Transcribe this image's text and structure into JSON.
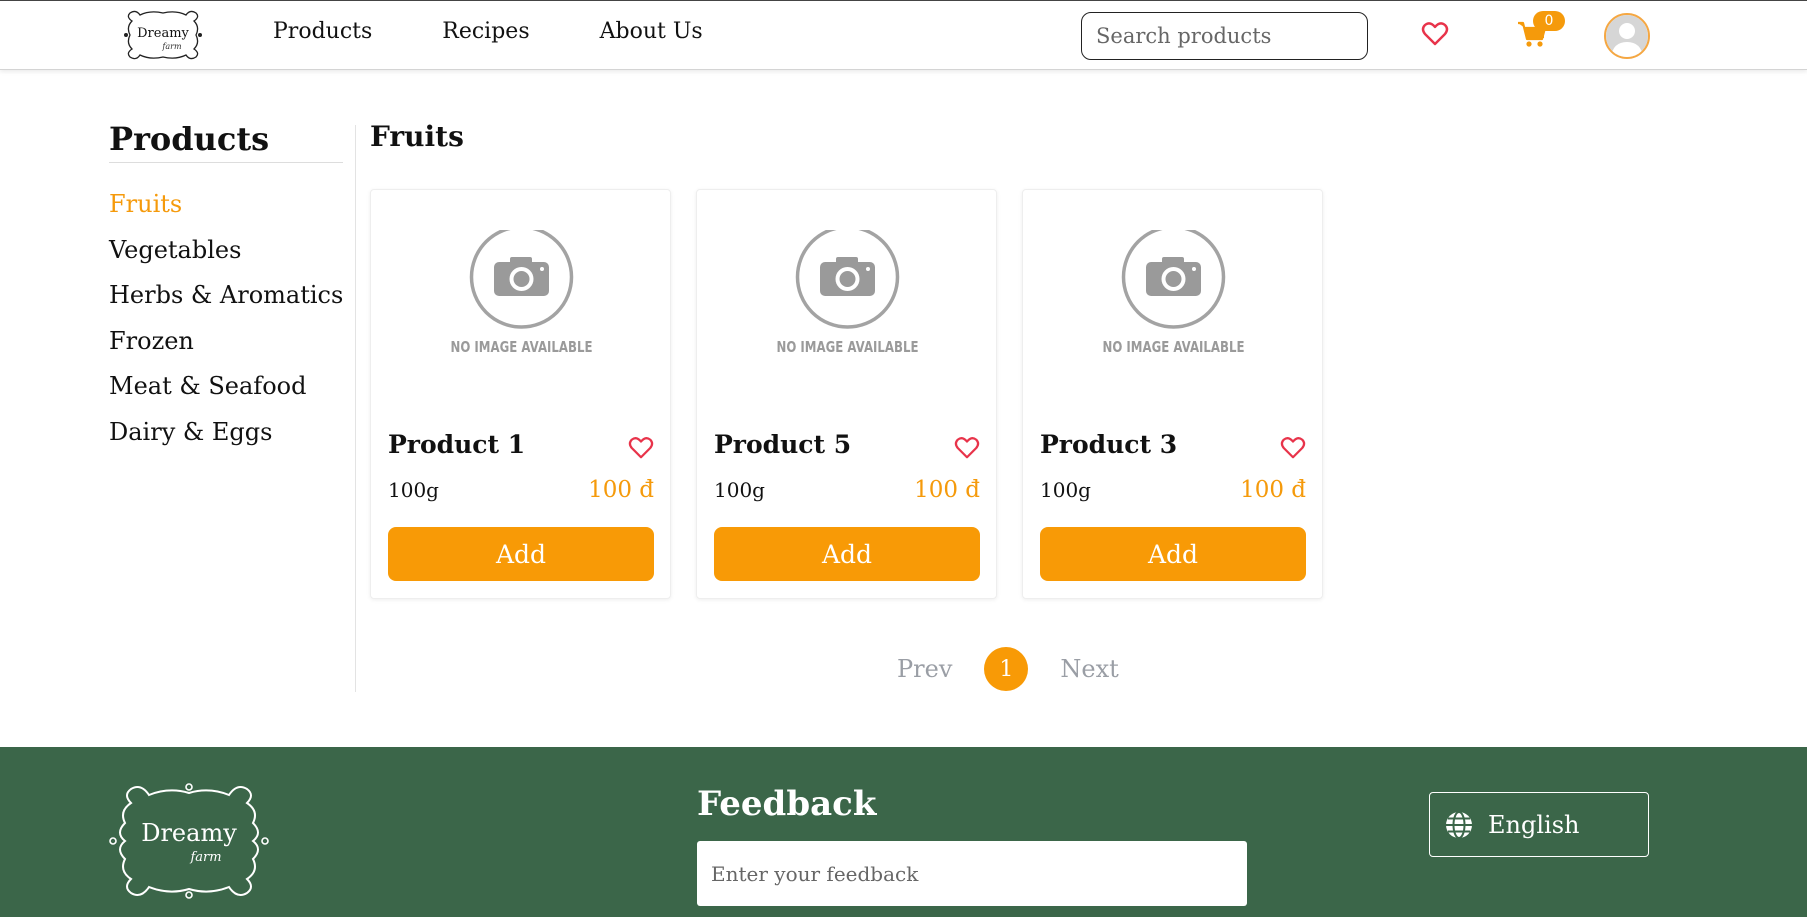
{
  "header": {
    "logo_text": "Dreamy",
    "logo_subtext": "farm",
    "nav": [
      "Products",
      "Recipes",
      "About Us"
    ],
    "search_placeholder": "Search products",
    "cart_count": "0"
  },
  "sidebar": {
    "title": "Products",
    "categories": [
      "Fruits",
      "Vegetables",
      "Herbs & Aromatics",
      "Frozen",
      "Meat & Seafood",
      "Dairy & Eggs"
    ],
    "active_index": 0
  },
  "main": {
    "category_title": "Fruits",
    "placeholder_text": "NO IMAGE AVAILABLE",
    "products": [
      {
        "name": "Product 1",
        "weight": "100g",
        "price": "100 đ",
        "button": "Add"
      },
      {
        "name": "Product 5",
        "weight": "100g",
        "price": "100 đ",
        "button": "Add"
      },
      {
        "name": "Product 3",
        "weight": "100g",
        "price": "100 đ",
        "button": "Add"
      }
    ]
  },
  "pagination": {
    "prev": "Prev",
    "current": "1",
    "next": "Next"
  },
  "footer": {
    "logo_text": "Dreamy",
    "logo_subtext": "farm",
    "feedback_title": "Feedback",
    "feedback_placeholder": "Enter your feedback",
    "language": "English"
  },
  "colors": {
    "accent": "#f89a06",
    "footer_bg": "#3b6649",
    "heart": "#e8334a"
  }
}
